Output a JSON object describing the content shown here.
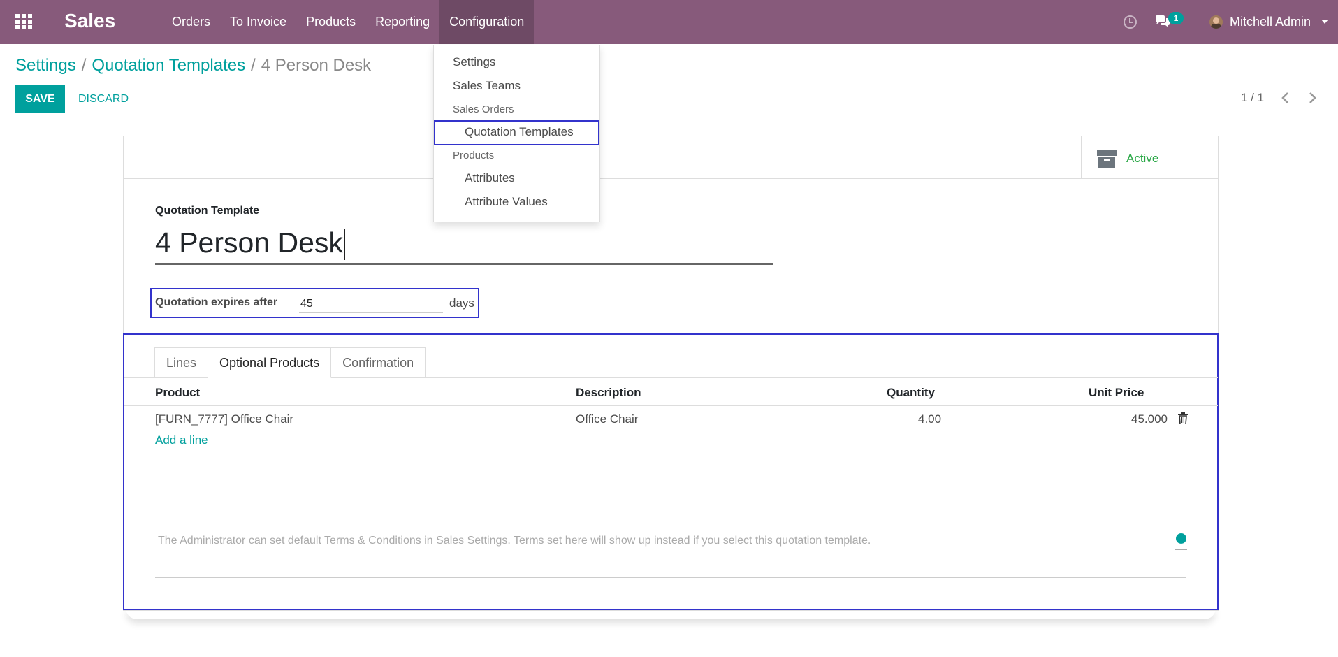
{
  "app": {
    "brand": "Sales"
  },
  "navbar": {
    "menu": [
      "Orders",
      "To Invoice",
      "Products",
      "Reporting",
      "Configuration"
    ],
    "chat_badge": "1",
    "user_name": "Mitchell Admin"
  },
  "breadcrumb": {
    "root": "Settings",
    "parent": "Quotation Templates",
    "current": "4 Person Desk",
    "separator": "/"
  },
  "control_panel": {
    "save_label": "SAVE",
    "discard_label": "DISCARD",
    "pager": "1 / 1"
  },
  "form": {
    "active_label": "Active",
    "template_label": "Quotation Template",
    "template_name": "4 Person Desk",
    "expires_label": "Quotation expires after",
    "expires_value": "45",
    "expires_suffix": "days",
    "tabs": [
      "Lines",
      "Optional Products",
      "Confirmation"
    ],
    "columns": {
      "product": "Product",
      "description": "Description",
      "quantity": "Quantity",
      "unit_price": "Unit Price"
    },
    "rows": [
      {
        "product": "[FURN_7777] Office Chair",
        "description": "Office Chair",
        "quantity": "4.00",
        "unit_price": "45.000"
      }
    ],
    "add_line": "Add a line",
    "terms_placeholder": "The Administrator can set default Terms & Conditions in Sales Settings. Terms set here will show up instead if you select this quotation template."
  },
  "dropdown": {
    "items": [
      "Settings",
      "Sales Teams"
    ],
    "header_orders": "Sales Orders",
    "orders_sub": [
      "Quotation Templates"
    ],
    "header_products": "Products",
    "products_sub": [
      "Attributes",
      "Attribute Values"
    ]
  },
  "colors": {
    "navbar": "#875a7b",
    "accent": "#00a09d",
    "highlight": "#3333cc",
    "active": "#28a745"
  }
}
